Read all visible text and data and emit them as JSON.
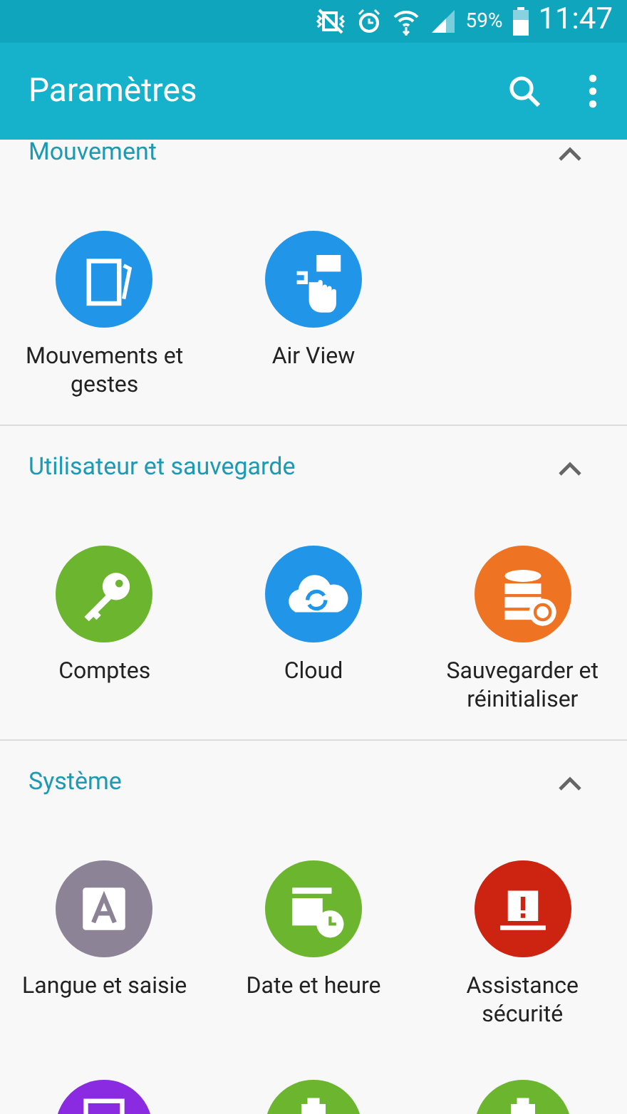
{
  "status_bar": {
    "battery_percent": "59%",
    "time": "11:47"
  },
  "app_bar": {
    "title": "Paramètres"
  },
  "sections": [
    {
      "title": "Mouvement",
      "expanded": true,
      "items": [
        {
          "kind": "motion",
          "color": "#2196e8",
          "label": "Mouvements et gestes"
        },
        {
          "kind": "airview",
          "color": "#2196e8",
          "label": "Air View"
        }
      ]
    },
    {
      "title": "Utilisateur et sauvegarde",
      "expanded": true,
      "items": [
        {
          "kind": "key",
          "color": "#6cb52e",
          "label": "Comptes"
        },
        {
          "kind": "cloud",
          "color": "#2196e8",
          "label": "Cloud"
        },
        {
          "kind": "backup",
          "color": "#ee7322",
          "label": "Sauvegarder et réinitialiser"
        }
      ]
    },
    {
      "title": "Système",
      "expanded": true,
      "items": [
        {
          "kind": "language",
          "color": "#8c8496",
          "label": "Langue et saisie"
        },
        {
          "kind": "datetime",
          "color": "#6cb52e",
          "label": "Date et heure"
        },
        {
          "kind": "alert",
          "color": "#cc2410",
          "label": "Assistance sécurité"
        },
        {
          "kind": "screen",
          "color": "#8a2be2"
        },
        {
          "kind": "battery",
          "color": "#6cb52e"
        },
        {
          "kind": "battery",
          "color": "#6cb52e"
        }
      ]
    }
  ]
}
